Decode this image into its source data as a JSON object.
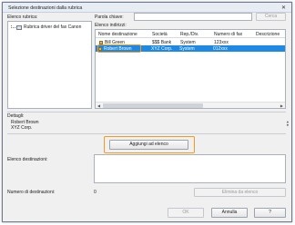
{
  "window": {
    "title": "Selezione destinazioni dalla rubrica",
    "close_glyph": "✕"
  },
  "address_book": {
    "label": "Elenco rubrica:",
    "tree_item": "Rubrica driver del fax Canon"
  },
  "search": {
    "label": "Parola chiave:",
    "value": "",
    "button": "Cerca"
  },
  "addresses": {
    "label": "Elenco indirizzi:",
    "columns": [
      "Nome destinazione",
      "Società",
      "Rep./Div.",
      "Numero di fax",
      "Descrizione"
    ],
    "rows": [
      {
        "name": "Bill Green",
        "company": "$$$ Bank",
        "dept": "System",
        "fax": "123xxx",
        "selected": false
      },
      {
        "name": "Robert Brown",
        "company": "XYZ Corp.",
        "dept": "System",
        "fax": "012xxx",
        "selected": true
      }
    ],
    "scroll_left": "◀",
    "scroll_right": "▶"
  },
  "details": {
    "label": "Dettagli:",
    "line1": "Robert Brown",
    "line2": "XYZ Corp."
  },
  "add_button": "Aggiungi ad elenco",
  "destinations": {
    "label": "Elenco destinazioni:"
  },
  "count": {
    "label": "Numero di destinazioni:",
    "value": "0"
  },
  "remove_button": "Elimina da elenco",
  "ok_button": "OK",
  "cancel_button": "Annulla",
  "help_button": "?",
  "colors": {
    "selection": "#1e88e5",
    "highlight": "#f29b1d"
  }
}
